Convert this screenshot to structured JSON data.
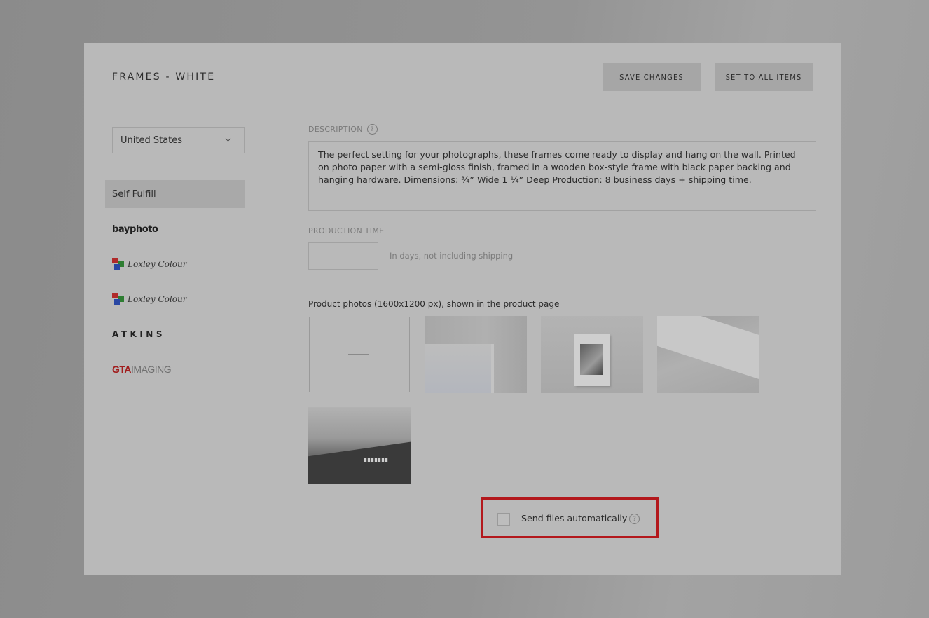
{
  "product_title": "FRAMES - WHITE",
  "country": {
    "selected": "United States"
  },
  "vendors": [
    {
      "name": "Self Fulfill"
    },
    {
      "logo": "bayphoto"
    },
    {
      "logo": "Loxley Colour"
    },
    {
      "logo": "Loxley Colour"
    },
    {
      "logo": "ATKINS"
    },
    {
      "logo_part1": "GTA",
      "logo_part2": "IMAGING"
    }
  ],
  "actions": {
    "save": "SAVE CHANGES",
    "set_all": "SET TO ALL ITEMS"
  },
  "description": {
    "label": "DESCRIPTION",
    "text": "The perfect setting for your photographs, these frames come ready to display and hang on the wall. Printed on photo paper with a semi-gloss finish, framed in a wooden box-style frame with black paper backing and hanging hardware. Dimensions: ¾” Wide 1 ¼” Deep Production: 8 business days + shipping time."
  },
  "production_time": {
    "label": "PRODUCTION TIME",
    "value": "",
    "hint": "In days, not including shipping"
  },
  "photos": {
    "label": "Product photos (1600x1200 px), shown in the product page"
  },
  "send_files": {
    "label": "Send files automatically",
    "checked": false
  },
  "icons": {
    "help": "?",
    "plus": "+"
  },
  "colors": {
    "highlight_border": "#b3181c"
  }
}
